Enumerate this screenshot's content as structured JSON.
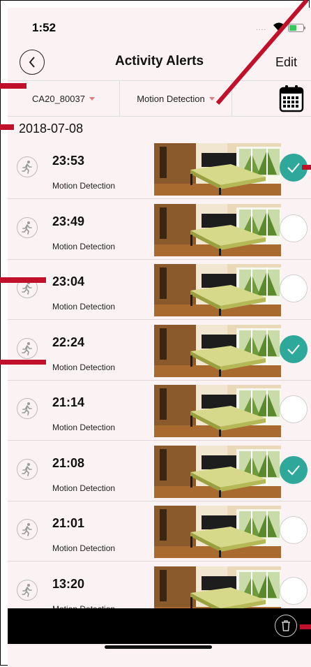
{
  "status_bar": {
    "time": "1:52",
    "signal": "...."
  },
  "header": {
    "title": "Activity Alerts",
    "edit_label": "Edit"
  },
  "filters": {
    "device": "CA20_80037",
    "type": "Motion Detection"
  },
  "date_header": "2018-07-08",
  "alerts": [
    {
      "time": "23:53",
      "type": "Motion Detection",
      "checked": true
    },
    {
      "time": "23:49",
      "type": "Motion Detection",
      "checked": false
    },
    {
      "time": "23:04",
      "type": "Motion Detection",
      "checked": false
    },
    {
      "time": "22:24",
      "type": "Motion Detection",
      "checked": true
    },
    {
      "time": "21:14",
      "type": "Motion Detection",
      "checked": false
    },
    {
      "time": "21:08",
      "type": "Motion Detection",
      "checked": true
    },
    {
      "time": "21:01",
      "type": "Motion Detection",
      "checked": false
    },
    {
      "time": "13:20",
      "type": "Motion Detection",
      "checked": false
    }
  ],
  "colors": {
    "accent": "#2fa89c",
    "caret": "#e47a86",
    "annotation": "#c0102a",
    "background": "#fbf2f3"
  },
  "icons": {
    "back": "chevron-left-icon",
    "calendar": "calendar-icon",
    "motion": "running-person-icon",
    "select": "checkmark-icon",
    "delete": "trash-icon"
  }
}
